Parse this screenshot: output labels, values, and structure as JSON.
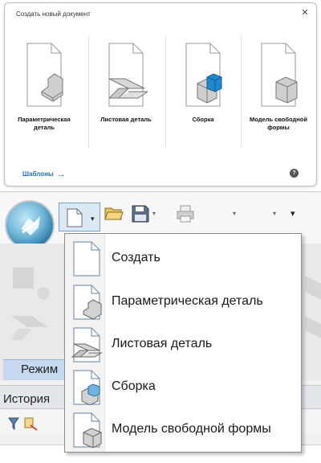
{
  "dialog": {
    "title": "Создать новый документ",
    "close": "✕",
    "tiles": [
      {
        "label": "Параметрическая деталь",
        "icon": "parametric-part-icon"
      },
      {
        "label": "Листовая деталь",
        "icon": "sheet-part-icon"
      },
      {
        "label": "Сборка",
        "icon": "assembly-icon"
      },
      {
        "label": "Модель свободной формы",
        "icon": "freeform-model-icon"
      }
    ],
    "templates_link": "Шаблоны",
    "help": "?"
  },
  "toolbar": {
    "new_dropdown_arrow": "▾",
    "extra_dropdown_arrow": "▾"
  },
  "ribbon": {
    "mode_label": "Режим"
  },
  "history": {
    "label": "История"
  },
  "menu": {
    "items": [
      {
        "label": "Создать",
        "icon": "new-document-icon"
      },
      {
        "label": "Параметрическая деталь",
        "icon": "parametric-part-icon"
      },
      {
        "label": "Листовая деталь",
        "icon": "sheet-part-icon"
      },
      {
        "label": "Сборка",
        "icon": "assembly-icon"
      },
      {
        "label": "Модель свободной формы",
        "icon": "freeform-model-icon"
      }
    ]
  },
  "colors": {
    "accent": "#1f6fb4",
    "assembly_blue": "#1e88d0",
    "menu_border": "#8e8e8e"
  }
}
